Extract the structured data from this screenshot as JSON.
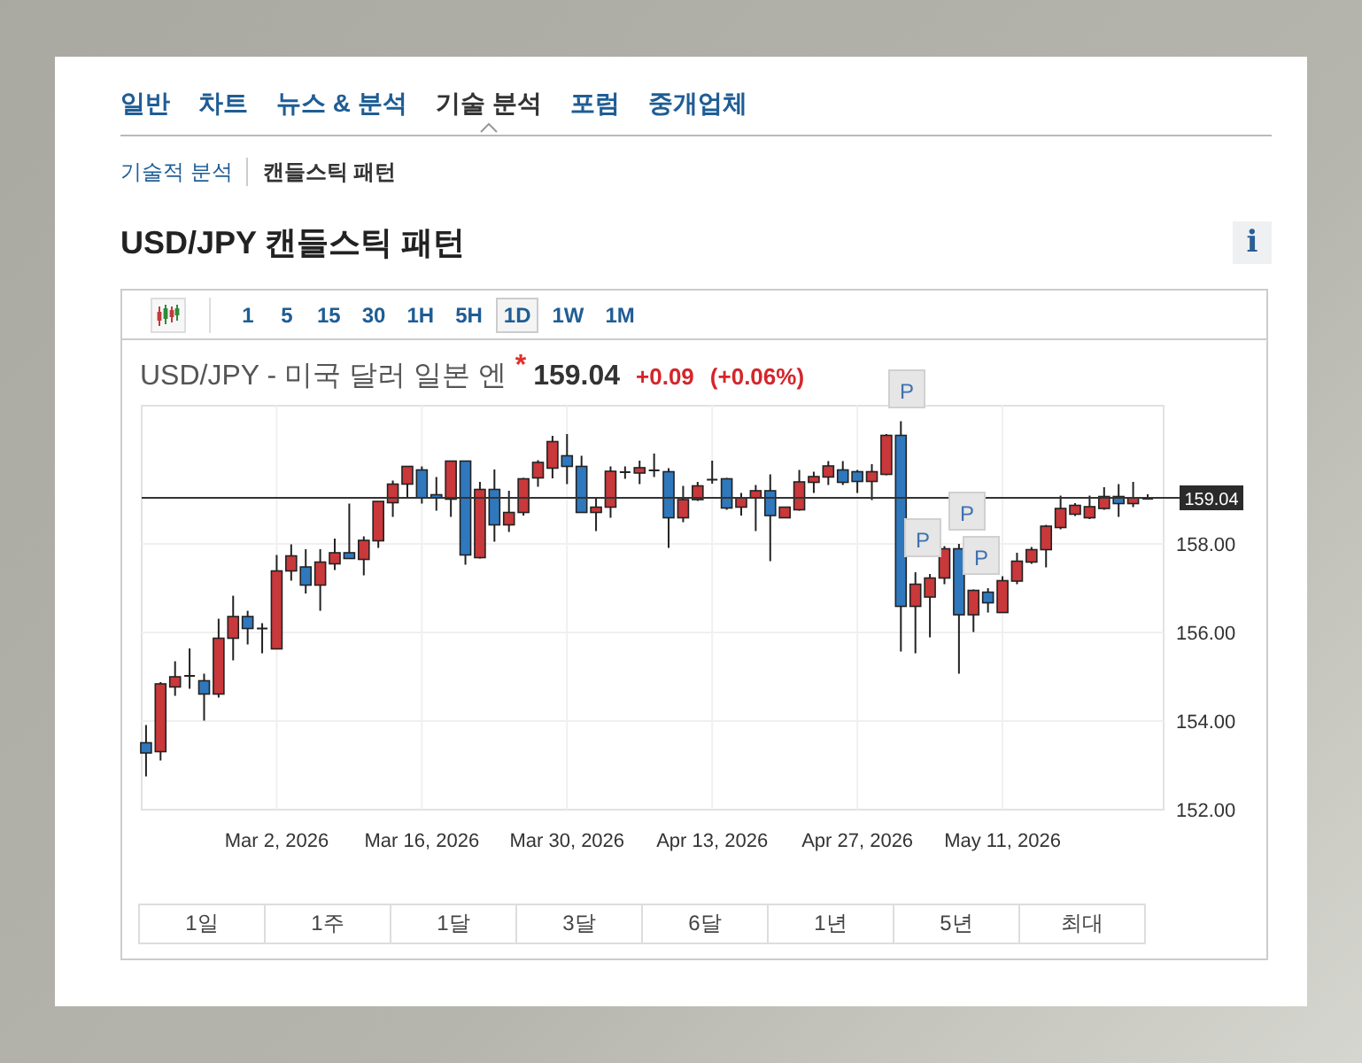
{
  "tabs": [
    {
      "label": "일반",
      "selected": false
    },
    {
      "label": "차트",
      "selected": false
    },
    {
      "label": "뉴스 & 분석",
      "selected": false
    },
    {
      "label": "기술 분석",
      "selected": true
    },
    {
      "label": "포럼",
      "selected": false
    },
    {
      "label": "중개업체",
      "selected": false
    }
  ],
  "subnav": [
    {
      "label": "기술적 분석",
      "selected": false
    },
    {
      "label": "캔들스틱 패턴",
      "selected": true
    }
  ],
  "title": "USD/JPY 캔들스틱 패턴",
  "info_button": "i",
  "chart": {
    "intervals": [
      {
        "label": "1",
        "selected": false
      },
      {
        "label": "5",
        "selected": false
      },
      {
        "label": "15",
        "selected": false
      },
      {
        "label": "30",
        "selected": false
      },
      {
        "label": "1H",
        "selected": false
      },
      {
        "label": "5H",
        "selected": false
      },
      {
        "label": "1D",
        "selected": true
      },
      {
        "label": "1W",
        "selected": false
      },
      {
        "label": "1M",
        "selected": false
      }
    ],
    "instrument": "USD/JPY - 미국 달러 일본 엔",
    "marker": "*",
    "price": "159.04",
    "change": "+0.09",
    "change_percent": "(+0.06%)",
    "pattern_markers": [
      "P",
      "P",
      "P",
      "P"
    ],
    "chart_data": {
      "type": "candlestick",
      "categories": [
        null,
        null,
        null,
        null,
        null,
        null,
        null,
        null,
        null,
        "Mar 2, 2026",
        null,
        null,
        null,
        null,
        null,
        null,
        null,
        null,
        null,
        "Mar 16, 2026",
        null,
        null,
        null,
        null,
        null,
        null,
        null,
        null,
        null,
        "Mar 30, 2026",
        null,
        null,
        null,
        null,
        null,
        null,
        null,
        null,
        null,
        "Apr 13, 2026",
        null,
        null,
        null,
        null,
        null,
        null,
        null,
        null,
        null,
        "Apr 27, 2026",
        null,
        null,
        null,
        null,
        null,
        null,
        null,
        null,
        null,
        "May 11, 2026",
        null,
        null,
        null,
        null,
        null,
        null,
        null,
        null,
        null,
        null
      ],
      "ohlc": [
        [
          153.51,
          153.91,
          152.75,
          153.28
        ],
        [
          153.31,
          154.88,
          153.11,
          154.84
        ],
        [
          154.77,
          155.35,
          154.57,
          155.0
        ],
        [
          155.04,
          155.64,
          154.73,
          155.04
        ],
        [
          154.91,
          155.07,
          154.01,
          154.61
        ],
        [
          154.61,
          156.31,
          154.53,
          155.87
        ],
        [
          155.87,
          156.83,
          155.37,
          156.36
        ],
        [
          156.36,
          156.49,
          155.73,
          156.09
        ],
        [
          156.11,
          156.21,
          155.53,
          156.11
        ],
        [
          155.63,
          157.75,
          155.63,
          157.39
        ],
        [
          157.39,
          157.99,
          157.17,
          157.73
        ],
        [
          157.48,
          157.88,
          156.88,
          157.07
        ],
        [
          157.07,
          157.88,
          156.49,
          157.59
        ],
        [
          157.55,
          158.12,
          157.41,
          157.8
        ],
        [
          157.8,
          158.91,
          157.67,
          157.67
        ],
        [
          157.65,
          158.17,
          157.29,
          158.08
        ],
        [
          158.07,
          158.96,
          157.91,
          158.96
        ],
        [
          158.93,
          159.43,
          158.61,
          159.35
        ],
        [
          159.35,
          159.75,
          159.04,
          159.75
        ],
        [
          159.67,
          159.75,
          158.91,
          159.04
        ],
        [
          159.11,
          159.51,
          158.75,
          159.04
        ],
        [
          159.01,
          159.87,
          158.61,
          159.87
        ],
        [
          159.87,
          159.87,
          157.53,
          157.75
        ],
        [
          157.69,
          159.4,
          157.67,
          159.23
        ],
        [
          159.23,
          159.68,
          158.05,
          158.43
        ],
        [
          158.43,
          159.2,
          158.27,
          158.71
        ],
        [
          158.71,
          159.49,
          158.64,
          159.47
        ],
        [
          159.49,
          159.89,
          159.29,
          159.84
        ],
        [
          159.71,
          160.44,
          159.48,
          160.31
        ],
        [
          159.99,
          160.48,
          159.35,
          159.75
        ],
        [
          159.75,
          159.99,
          158.71,
          158.71
        ],
        [
          158.71,
          159.05,
          158.29,
          158.83
        ],
        [
          158.83,
          159.75,
          158.59,
          159.64
        ],
        [
          159.64,
          159.75,
          159.47,
          159.64
        ],
        [
          159.6,
          159.88,
          159.35,
          159.72
        ],
        [
          159.68,
          160.04,
          159.51,
          159.68
        ],
        [
          159.63,
          159.71,
          157.91,
          158.59
        ],
        [
          158.59,
          159.31,
          158.49,
          159.0
        ],
        [
          159.0,
          159.4,
          158.97,
          159.31
        ],
        [
          159.47,
          159.88,
          159.36,
          159.47
        ],
        [
          159.47,
          159.49,
          158.77,
          158.81
        ],
        [
          158.83,
          159.15,
          158.64,
          159.04
        ],
        [
          159.04,
          159.33,
          158.29,
          159.2
        ],
        [
          159.2,
          159.57,
          157.61,
          158.64
        ],
        [
          158.59,
          158.83,
          158.59,
          158.83
        ],
        [
          158.77,
          159.67,
          158.75,
          159.4
        ],
        [
          159.39,
          159.63,
          159.15,
          159.52
        ],
        [
          159.51,
          159.87,
          159.33,
          159.76
        ],
        [
          159.67,
          159.87,
          159.33,
          159.39
        ],
        [
          159.63,
          159.67,
          159.15,
          159.41
        ],
        [
          159.41,
          159.8,
          158.99,
          159.63
        ],
        [
          159.57,
          160.48,
          159.55,
          160.45
        ],
        [
          160.45,
          160.77,
          155.57,
          156.59
        ],
        [
          156.59,
          157.36,
          155.53,
          157.09
        ],
        [
          156.8,
          157.32,
          155.89,
          157.23
        ],
        [
          157.23,
          157.95,
          157.09,
          157.89
        ],
        [
          157.89,
          158.0,
          155.07,
          156.4
        ],
        [
          156.4,
          156.97,
          156.01,
          156.95
        ],
        [
          156.91,
          157.0,
          156.45,
          156.67
        ],
        [
          156.45,
          157.27,
          156.45,
          157.17
        ],
        [
          157.16,
          157.8,
          157.09,
          157.61
        ],
        [
          157.59,
          157.93,
          157.55,
          157.87
        ],
        [
          157.87,
          158.43,
          157.47,
          158.4
        ],
        [
          158.37,
          159.09,
          158.33,
          158.8
        ],
        [
          158.67,
          158.92,
          158.63,
          158.87
        ],
        [
          158.59,
          159.09,
          158.56,
          158.84
        ],
        [
          158.8,
          159.28,
          158.77,
          159.07
        ],
        [
          159.07,
          159.35,
          158.61,
          158.91
        ],
        [
          158.91,
          159.4,
          158.83,
          159.04
        ],
        [
          159.04,
          159.12,
          159.0,
          159.04
        ]
      ],
      "ylim": [
        152,
        161.12
      ],
      "grid": true,
      "ref_lines": [
        {
          "axis": "y",
          "value": 159.04,
          "label": "159.04"
        }
      ],
      "yticks": [
        {
          "value": 158,
          "label": "158.00"
        },
        {
          "value": 156,
          "label": "156.00"
        },
        {
          "value": 154,
          "label": "154.00"
        },
        {
          "value": 152,
          "label": "152.00"
        }
      ]
    }
  },
  "ranges": [
    "1일",
    "1주",
    "1달",
    "3달",
    "6달",
    "1년",
    "5년",
    "최대"
  ]
}
